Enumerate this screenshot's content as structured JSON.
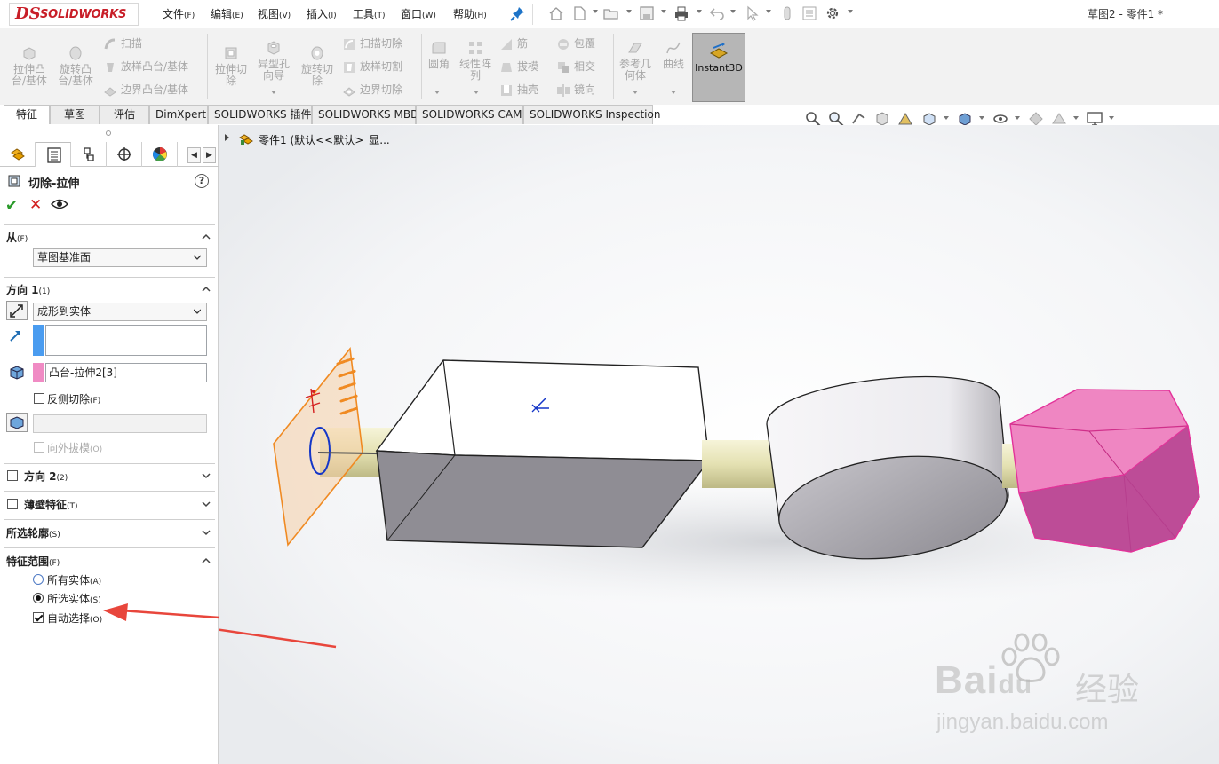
{
  "app": {
    "logo_ds": "DS",
    "logo_text": "SOLIDWORKS",
    "document_title": "草图2 - 零件1 *"
  },
  "menu": {
    "items": [
      {
        "label": "文件",
        "key": "(F)"
      },
      {
        "label": "编辑",
        "key": "(E)"
      },
      {
        "label": "视图",
        "key": "(V)"
      },
      {
        "label": "插入",
        "key": "(I)"
      },
      {
        "label": "工具",
        "key": "(T)"
      },
      {
        "label": "窗口",
        "key": "(W)"
      },
      {
        "label": "帮助",
        "key": "(H)"
      }
    ]
  },
  "ribbon": {
    "extrude_boss": "拉伸凸\n台/基体",
    "revolve_boss": "旋转凸\n台/基体",
    "sweep": "扫描",
    "loft_boss": "放样凸台/基体",
    "boundary_boss": "边界凸台/基体",
    "extrude_cut": "拉伸切\n除",
    "hole_wizard": "异型孔\n向导",
    "revolve_cut": "旋转切\n除",
    "sweep_cut": "扫描切除",
    "loft_cut": "放样切割",
    "boundary_cut": "边界切除",
    "fillet": "圆角",
    "linear_pattern": "线性阵\n列",
    "rib": "筋",
    "draft": "拔模",
    "shell": "抽壳",
    "wrap": "包覆",
    "intersect": "相交",
    "mirror": "镜向",
    "ref_geometry": "参考几\n何体",
    "curves": "曲线",
    "instant3d": "Instant3D"
  },
  "tabs": [
    {
      "label": "特征",
      "active": true
    },
    {
      "label": "草图",
      "active": false
    },
    {
      "label": "评估",
      "active": false
    },
    {
      "label": "DimXpert",
      "active": false
    },
    {
      "label": "SOLIDWORKS 插件",
      "active": false
    },
    {
      "label": "SOLIDWORKS MBD",
      "active": false
    },
    {
      "label": "SOLIDWORKS CAM",
      "active": false
    },
    {
      "label": "SOLIDWORKS Inspection",
      "active": false
    }
  ],
  "property_manager": {
    "title": "切除-拉伸",
    "help": "?",
    "from": {
      "label": "从",
      "key": "(F)",
      "value": "草图基准面"
    },
    "direction1": {
      "label": "方向 1",
      "key": "(1)",
      "end_condition": "成形到实体",
      "selected_body": "凸台-拉伸2[3]",
      "flip_side_label": "反侧切除",
      "flip_side_key": "(F)",
      "draft_outward_label": "向外拔模",
      "draft_outward_key": "(O)"
    },
    "direction2": {
      "label": "方向 2",
      "key": "(2)"
    },
    "thin_feature": {
      "label": "薄壁特征",
      "key": "(T)"
    },
    "selected_contours": {
      "label": "所选轮廓",
      "key": "(S)"
    },
    "feature_scope": {
      "label": "特征范围",
      "key": "(F)",
      "all_bodies": "所有实体",
      "all_bodies_key": "(A)",
      "selected_bodies": "所选实体",
      "selected_bodies_key": "(S)",
      "auto_select": "自动选择",
      "auto_select_key": "(O)"
    }
  },
  "tree": {
    "root_label": "零件1  (默认<<默认>_显..."
  },
  "watermark": {
    "brand": "Bai",
    "brand2": "du",
    "cn": "经验",
    "url": "jingyan.baidu.com"
  },
  "colors": {
    "brand_red": "#c81e28",
    "selection_pink": "#f08bc4",
    "face_blue": "#4a9cf0",
    "annotation_arrow": "#e8463c"
  }
}
